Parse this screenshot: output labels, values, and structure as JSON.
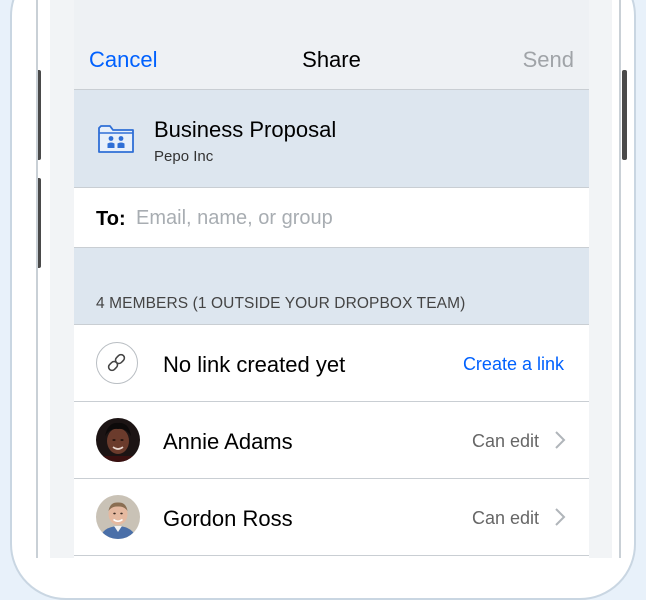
{
  "navbar": {
    "cancel_label": "Cancel",
    "title": "Share",
    "send_label": "Send"
  },
  "folder": {
    "name": "Business Proposal",
    "team": "Pepo Inc",
    "icon": "team-folder-icon"
  },
  "recipient": {
    "label": "To:",
    "value": "",
    "placeholder": "Email, name, or group"
  },
  "members": {
    "header": "4 MEMBERS (1 OUTSIDE YOUR DROPBOX TEAM)"
  },
  "link_row": {
    "icon": "link-icon",
    "text": "No link created yet",
    "action_label": "Create a link"
  },
  "member_list": [
    {
      "name": "Annie Adams",
      "permission": "Can edit"
    },
    {
      "name": "Gordon Ross",
      "permission": "Can edit"
    }
  ],
  "colors": {
    "accent": "#0061fe",
    "disabled": "#a0a4a8",
    "section_bg": "#dde6ef",
    "page_bg": "#e8f1fa"
  }
}
